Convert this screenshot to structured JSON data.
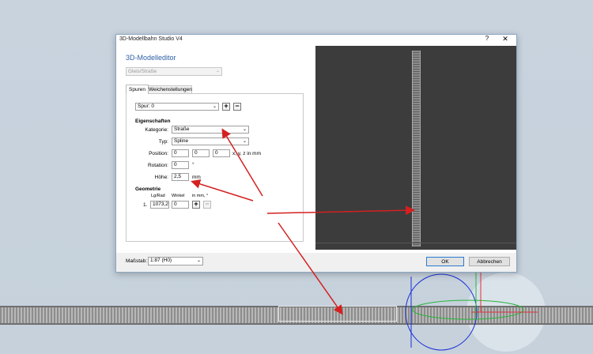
{
  "window": {
    "title": "3D-Modellbahn Studio V4",
    "help_glyph": "?",
    "close_glyph": "✕"
  },
  "editor": {
    "heading": "3D-Modelleditor",
    "object_type": "Gleis/Straße",
    "tabs": [
      {
        "label": "Spuren"
      },
      {
        "label": "Weichenstellungen"
      }
    ]
  },
  "spuren": {
    "track_select": "Spur: 0",
    "add_glyph": "+",
    "remove_glyph": "−",
    "eigenschaften_title": "Eigenschaften",
    "kategorie_label": "Kategorie:",
    "kategorie_value": "Straße",
    "typ_label": "Typ:",
    "typ_value": "Spline",
    "position_label": "Position:",
    "position_values": [
      "0",
      "0",
      "0"
    ],
    "position_unit": "x, y, z in mm",
    "rotation_label": "Rotation:",
    "rotation_value": "0",
    "rotation_unit": "°",
    "hoehe_label": "Höhe:",
    "hoehe_value": "2,5",
    "hoehe_unit": "mm",
    "geometrie_title": "Geometrie",
    "geometrie_headers": {
      "length": "Lg/Rad",
      "angle": "Winkel",
      "unit": "in mm, °"
    },
    "geometrie_rows": [
      {
        "index": "1.",
        "length": "1073,2",
        "angle": "0"
      }
    ]
  },
  "footer": {
    "scale_label": "Maßstab:",
    "scale_value": "1:87 (H0)",
    "ok_label": "OK",
    "cancel_label": "Abbrechen"
  },
  "colors": {
    "accent": "#2d5fa5",
    "annotation_arrow": "#d42020",
    "viewport_bg": "#3c3c3c",
    "scene_bg": "#c8d3de"
  }
}
